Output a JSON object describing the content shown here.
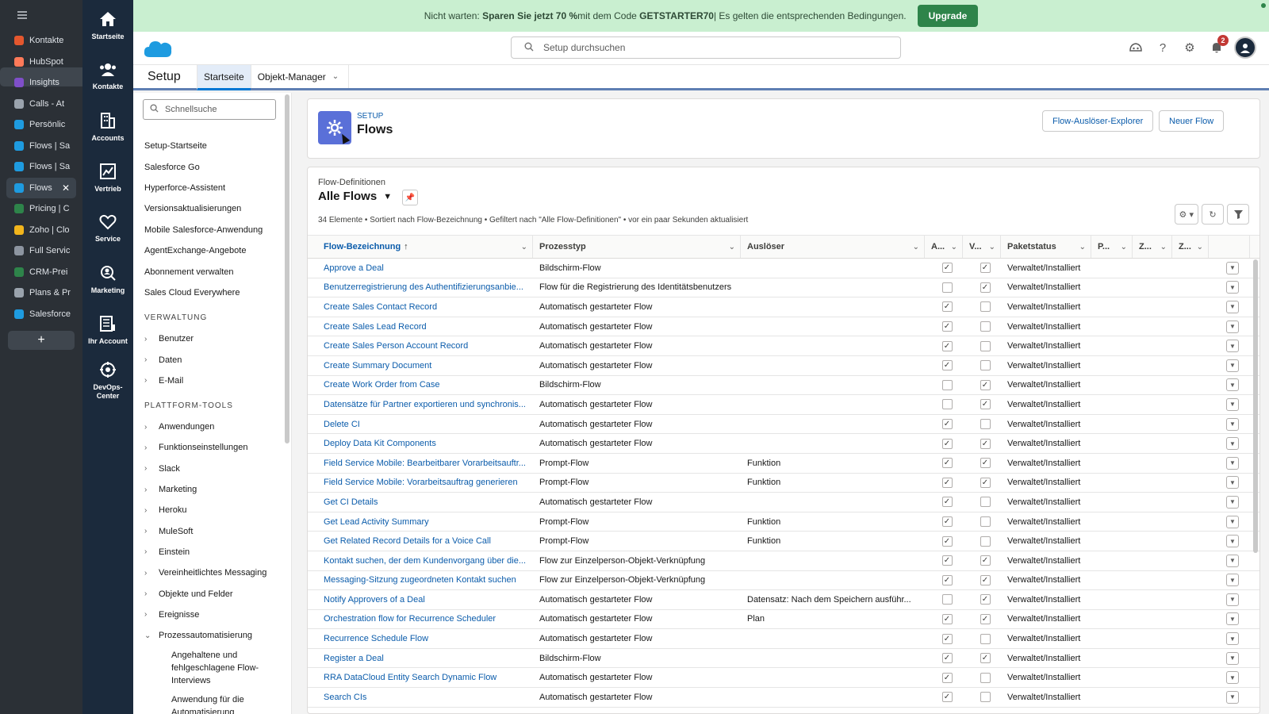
{
  "tabs": [
    {
      "label": "Kontakte",
      "color": "#e4572e"
    },
    {
      "label": "HubSpot",
      "color": "#ff7a59"
    },
    {
      "label": "Insights",
      "color": "#7f4fc9"
    },
    {
      "label": "Calls - At",
      "color": "#9aa3ad"
    },
    {
      "label": "Persönlic",
      "color": "#1e9be0"
    },
    {
      "label": "Flows | Sa",
      "color": "#1e9be0"
    },
    {
      "label": "Flows | Sa",
      "color": "#1e9be0"
    },
    {
      "label": "Flows",
      "color": "#1e9be0",
      "active": true
    },
    {
      "label": "Pricing | C",
      "color": "#2e844a"
    },
    {
      "label": "Zoho | Clo",
      "color": "#f2b51c"
    },
    {
      "label": "Full Servic",
      "color": "#8c94a0"
    },
    {
      "label": "CRM-Prei",
      "color": "#2e844a"
    },
    {
      "label": "Plans & Pr",
      "color": "#9aa3ad"
    },
    {
      "label": "Salesforce",
      "color": "#1e9be0"
    }
  ],
  "tab_add_label": "+",
  "tab_close_label": "✕",
  "appnav": [
    {
      "label": "Startseite",
      "icon": "home-icon"
    },
    {
      "label": "Kontakte",
      "icon": "contacts-icon"
    },
    {
      "label": "Accounts",
      "icon": "building-icon"
    },
    {
      "label": "Vertrieb",
      "icon": "chart-icon"
    },
    {
      "label": "Service",
      "icon": "heart-icon"
    },
    {
      "label": "Marketing",
      "icon": "marketing-icon"
    },
    {
      "label": "Ihr Account",
      "icon": "account-grid-icon"
    },
    {
      "label": "DevOps-Center",
      "icon": "devops-icon"
    }
  ],
  "banner": {
    "prefix": "Nicht warten: ",
    "bold1": "Sparen Sie jetzt 70 %",
    "middle": " mit dem Code ",
    "code": "GETSTARTER70",
    "suffix": " | Es gelten die entsprechenden Bedingungen.",
    "button": "Upgrade"
  },
  "header": {
    "search_placeholder": "Setup durchsuchen",
    "notification_count": "2"
  },
  "setupbar": {
    "title": "Setup",
    "tab_home": "Startseite",
    "tab_object_manager": "Objekt-Manager"
  },
  "sidebar": {
    "quickfind_placeholder": "Schnellsuche",
    "links": [
      "Setup-Startseite",
      "Salesforce Go",
      "Hyperforce-Assistent",
      "Versionsaktualisierungen",
      "Mobile Salesforce-Anwendung",
      "AgentExchange-Angebote",
      "Abonnement verwalten",
      "Sales Cloud Everywhere"
    ],
    "section_admin": "VERWALTUNG",
    "admin_items": [
      "Benutzer",
      "Daten",
      "E-Mail"
    ],
    "section_platform": "PLATTFORM-TOOLS",
    "platform_items": [
      "Anwendungen",
      "Funktionseinstellungen",
      "Slack",
      "Marketing",
      "Heroku",
      "MuleSoft",
      "Einstein",
      "Vereinheitlichtes Messaging",
      "Objekte und Felder",
      "Ereignisse"
    ],
    "expanded_item": "Prozessautomatisierung",
    "sub_items": [
      "Angehaltene und fehlgeschlagene Flow-Interviews",
      "Anwendung für die Automatisierung"
    ]
  },
  "page": {
    "eyebrow": "SETUP",
    "title": "Flows",
    "btn_explorer": "Flow-Auslöser-Explorer",
    "btn_new": "Neuer Flow"
  },
  "listview": {
    "eyebrow": "Flow-Definitionen",
    "title": "Alle Flows",
    "meta": "34 Elemente • Sortiert nach Flow-Bezeichnung • Gefiltert nach \"Alle Flow-Definitionen\" • vor ein paar Sekunden aktualisiert",
    "columns": {
      "name": "Flow-Bezeichnung",
      "type": "Prozesstyp",
      "trigger": "Auslöser",
      "a": "A...",
      "v": "V...",
      "pkg": "Paketstatus",
      "p": "P...",
      "z1": "Z...",
      "z2": "Z..."
    },
    "rows": [
      {
        "name": "Approve a Deal",
        "type": "Bildschirm-Flow",
        "trigger": "",
        "a": true,
        "v": true,
        "pkg": "Verwaltet/Installiert"
      },
      {
        "name": "Benutzerregistrierung des Authentifizierungsanbie...",
        "type": "Flow für die Registrierung des Identitätsbenutzers",
        "trigger": "",
        "a": false,
        "v": true,
        "pkg": "Verwaltet/Installiert"
      },
      {
        "name": "Create Sales Contact Record",
        "type": "Automatisch gestarteter Flow",
        "trigger": "",
        "a": true,
        "v": false,
        "pkg": "Verwaltet/Installiert"
      },
      {
        "name": "Create Sales Lead Record",
        "type": "Automatisch gestarteter Flow",
        "trigger": "",
        "a": true,
        "v": false,
        "pkg": "Verwaltet/Installiert"
      },
      {
        "name": "Create Sales Person Account Record",
        "type": "Automatisch gestarteter Flow",
        "trigger": "",
        "a": true,
        "v": false,
        "pkg": "Verwaltet/Installiert"
      },
      {
        "name": "Create Summary Document",
        "type": "Automatisch gestarteter Flow",
        "trigger": "",
        "a": true,
        "v": false,
        "pkg": "Verwaltet/Installiert"
      },
      {
        "name": "Create Work Order from Case",
        "type": "Bildschirm-Flow",
        "trigger": "",
        "a": false,
        "v": true,
        "pkg": "Verwaltet/Installiert"
      },
      {
        "name": "Datensätze für Partner exportieren und synchronis...",
        "type": "Automatisch gestarteter Flow",
        "trigger": "",
        "a": false,
        "v": true,
        "pkg": "Verwaltet/Installiert"
      },
      {
        "name": "Delete CI",
        "type": "Automatisch gestarteter Flow",
        "trigger": "",
        "a": true,
        "v": false,
        "pkg": "Verwaltet/Installiert"
      },
      {
        "name": "Deploy Data Kit Components",
        "type": "Automatisch gestarteter Flow",
        "trigger": "",
        "a": true,
        "v": true,
        "pkg": "Verwaltet/Installiert"
      },
      {
        "name": "Field Service Mobile: Bearbeitbarer Vorarbeitsauftr...",
        "type": "Prompt-Flow",
        "trigger": "Funktion",
        "a": true,
        "v": true,
        "pkg": "Verwaltet/Installiert"
      },
      {
        "name": "Field Service Mobile: Vorarbeitsauftrag generieren",
        "type": "Prompt-Flow",
        "trigger": "Funktion",
        "a": true,
        "v": true,
        "pkg": "Verwaltet/Installiert"
      },
      {
        "name": "Get CI Details",
        "type": "Automatisch gestarteter Flow",
        "trigger": "",
        "a": true,
        "v": false,
        "pkg": "Verwaltet/Installiert"
      },
      {
        "name": "Get Lead Activity Summary",
        "type": "Prompt-Flow",
        "trigger": "Funktion",
        "a": true,
        "v": false,
        "pkg": "Verwaltet/Installiert"
      },
      {
        "name": "Get Related Record Details for a Voice Call",
        "type": "Prompt-Flow",
        "trigger": "Funktion",
        "a": true,
        "v": false,
        "pkg": "Verwaltet/Installiert"
      },
      {
        "name": "Kontakt suchen, der dem Kundenvorgang über die...",
        "type": "Flow zur Einzelperson-Objekt-Verknüpfung",
        "trigger": "",
        "a": true,
        "v": true,
        "pkg": "Verwaltet/Installiert"
      },
      {
        "name": "Messaging-Sitzung zugeordneten Kontakt suchen",
        "type": "Flow zur Einzelperson-Objekt-Verknüpfung",
        "trigger": "",
        "a": true,
        "v": true,
        "pkg": "Verwaltet/Installiert"
      },
      {
        "name": "Notify Approvers of a Deal",
        "type": "Automatisch gestarteter Flow",
        "trigger": "Datensatz: Nach dem Speichern ausführ...",
        "a": false,
        "v": true,
        "pkg": "Verwaltet/Installiert"
      },
      {
        "name": "Orchestration flow for Recurrence Scheduler",
        "type": "Automatisch gestarteter Flow",
        "trigger": "Plan",
        "a": true,
        "v": true,
        "pkg": "Verwaltet/Installiert"
      },
      {
        "name": "Recurrence Schedule Flow",
        "type": "Automatisch gestarteter Flow",
        "trigger": "",
        "a": true,
        "v": false,
        "pkg": "Verwaltet/Installiert"
      },
      {
        "name": "Register a Deal",
        "type": "Bildschirm-Flow",
        "trigger": "",
        "a": true,
        "v": true,
        "pkg": "Verwaltet/Installiert"
      },
      {
        "name": "RRA DataCloud Entity Search Dynamic Flow",
        "type": "Automatisch gestarteter Flow",
        "trigger": "",
        "a": true,
        "v": false,
        "pkg": "Verwaltet/Installiert"
      },
      {
        "name": "Search CIs",
        "type": "Automatisch gestarteter Flow",
        "trigger": "",
        "a": true,
        "v": false,
        "pkg": "Verwaltet/Installiert"
      }
    ]
  }
}
